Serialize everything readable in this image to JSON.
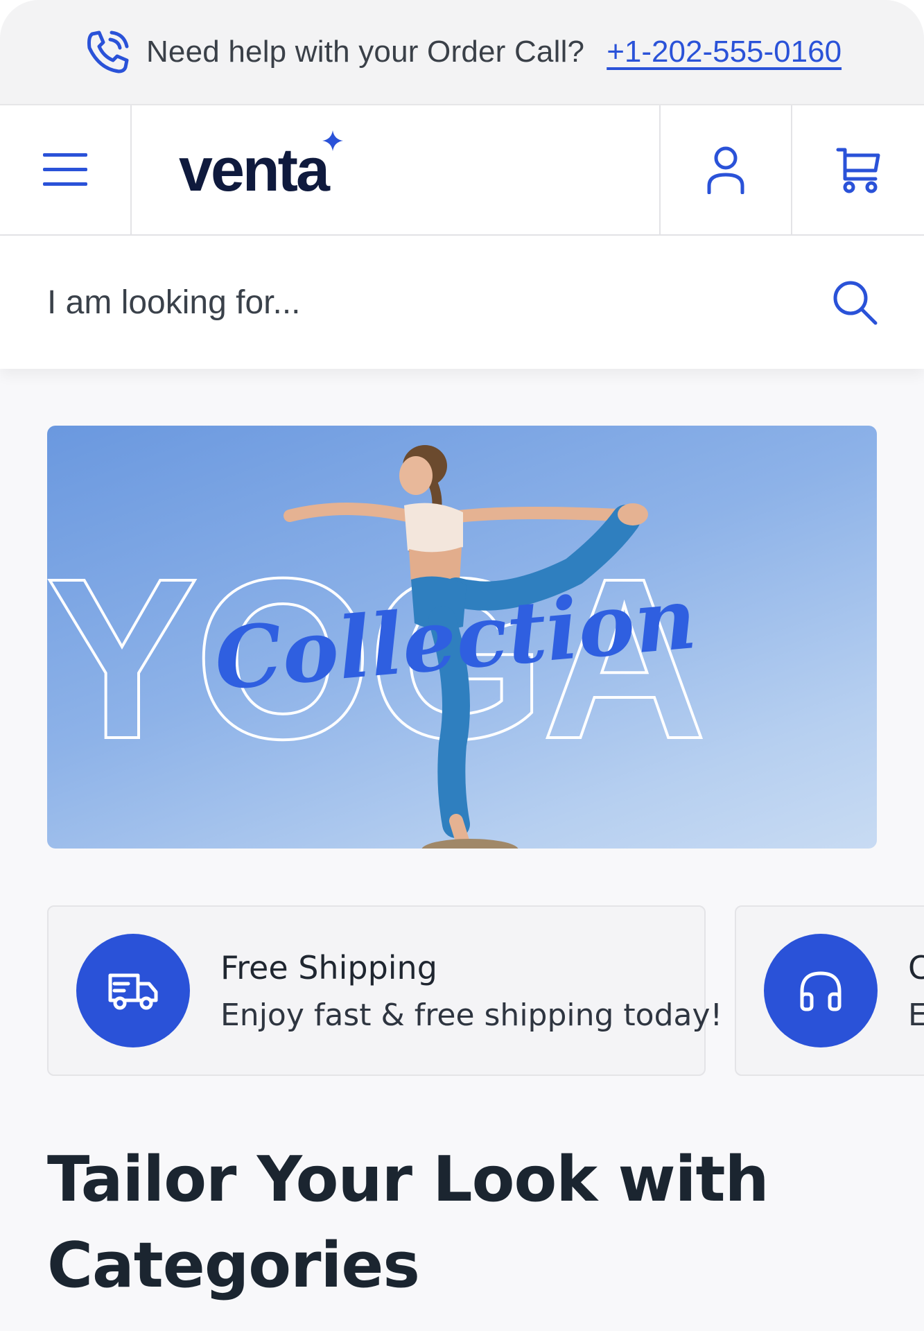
{
  "helpbar": {
    "text": "Need help with your Order Call?",
    "phone": "+1-202-555-0160",
    "icon": "phone-call-icon"
  },
  "header": {
    "menu_icon": "hamburger-menu-icon",
    "logo": "venta",
    "user_icon": "user-icon",
    "cart_icon": "cart-icon"
  },
  "search": {
    "placeholder": "I am looking for...",
    "icon": "search-icon"
  },
  "hero": {
    "title_outline": "YOGA",
    "title_script": "Collection"
  },
  "features": [
    {
      "icon": "truck-icon",
      "title": "Free Shipping",
      "description": "Enjoy fast & free shipping today!"
    },
    {
      "icon": "headphones-icon",
      "title": "C",
      "description": "E"
    }
  ],
  "section": {
    "heading": "Tailor Your Look with Categories"
  },
  "colors": {
    "accent": "#2a52d8",
    "logo": "#0f1a3d",
    "text": "#1c2530",
    "background": "#f8f8fa"
  }
}
